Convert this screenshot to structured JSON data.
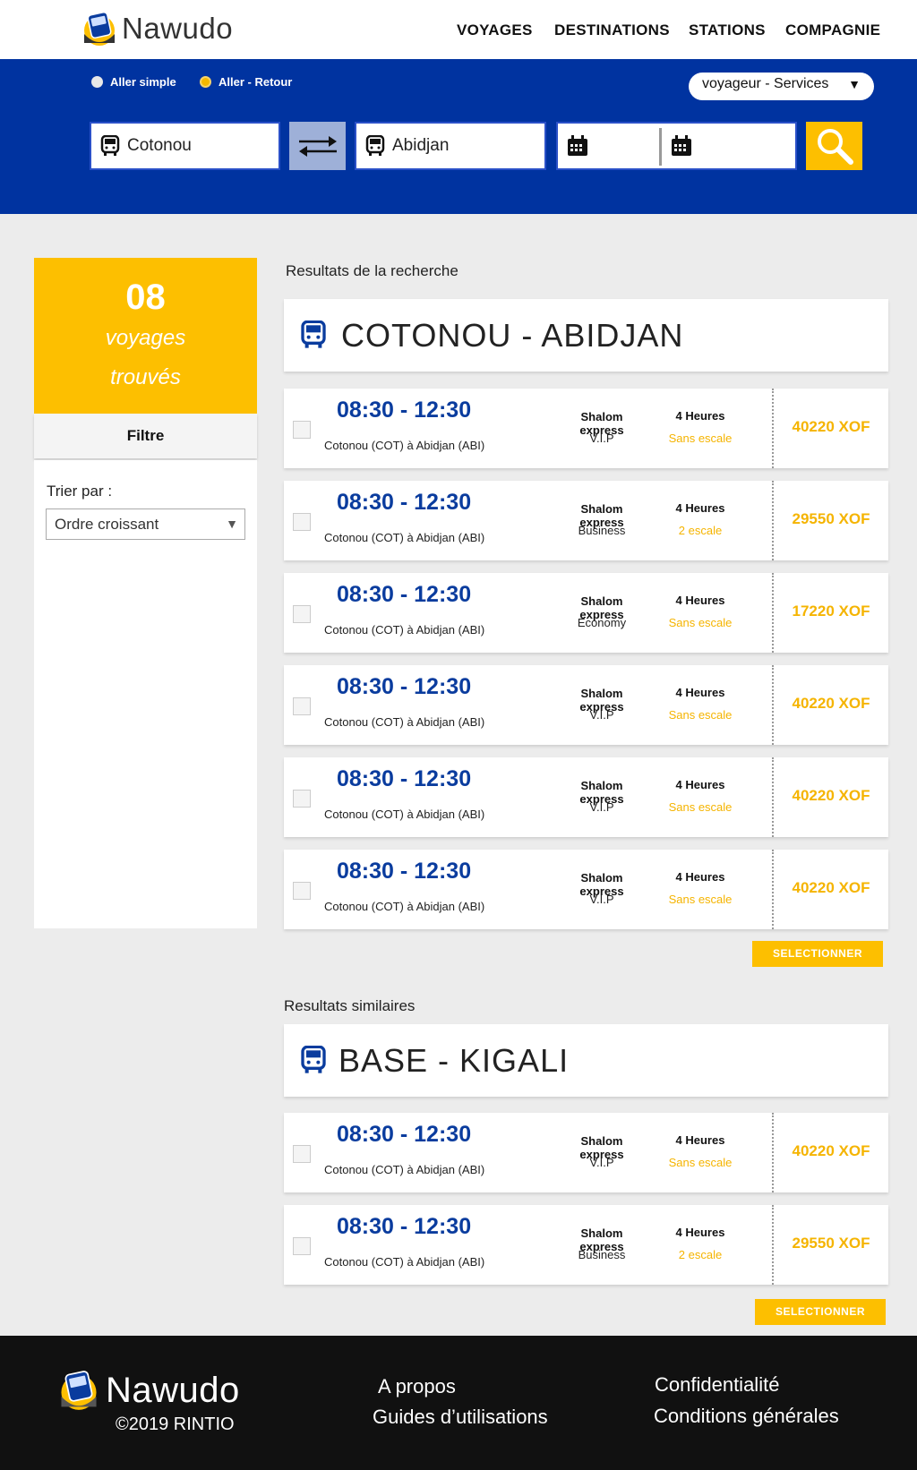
{
  "brand": {
    "name": "Nawudo"
  },
  "nav": [
    "VOYAGES",
    "DESTINATIONS",
    "STATIONS",
    "COMPAGNIE"
  ],
  "search": {
    "radio_one_way": "Aller simple",
    "radio_round_trip": "Aller - Retour",
    "selected_trip_type": "Aller - Retour",
    "services_select": "voyageur - Services",
    "from": "Cotonou",
    "to": "Abidjan"
  },
  "summary": {
    "count": "08",
    "label_line1": "voyages",
    "label_line2": "trouvés"
  },
  "filter": {
    "title": "Filtre",
    "sort_label": "Trier par :",
    "sort_value": "Ordre croissant"
  },
  "results": {
    "title": "Resultats de la recherche",
    "route": "COTONOU - ABIDJAN",
    "select_label": "SELECTIONNER",
    "trips": [
      {
        "time": "08:30 - 12:30",
        "path": "Cotonou (COT) à Abidjan (ABI)",
        "company": "Shalom express",
        "class": "V.I.P",
        "duration": "4 Heures",
        "stops": "Sans escale",
        "price": "40220 XOF"
      },
      {
        "time": "08:30 - 12:30",
        "path": "Cotonou (COT) à Abidjan (ABI)",
        "company": "Shalom express",
        "class": "Business",
        "duration": "4 Heures",
        "stops": "2 escale",
        "price": "29550 XOF"
      },
      {
        "time": "08:30 - 12:30",
        "path": "Cotonou (COT) à Abidjan (ABI)",
        "company": "Shalom express",
        "class": "Economy",
        "duration": "4 Heures",
        "stops": "Sans escale",
        "price": "17220 XOF"
      },
      {
        "time": "08:30 - 12:30",
        "path": "Cotonou (COT) à Abidjan (ABI)",
        "company": "Shalom express",
        "class": "V.I.P",
        "duration": "4 Heures",
        "stops": "Sans escale",
        "price": "40220 XOF"
      },
      {
        "time": "08:30 - 12:30",
        "path": "Cotonou (COT) à Abidjan (ABI)",
        "company": "Shalom express",
        "class": "V.I.P",
        "duration": "4 Heures",
        "stops": "Sans escale",
        "price": "40220 XOF"
      },
      {
        "time": "08:30 - 12:30",
        "path": "Cotonou (COT) à Abidjan (ABI)",
        "company": "Shalom express",
        "class": "V.I.P",
        "duration": "4 Heures",
        "stops": "Sans escale",
        "price": "40220 XOF"
      }
    ]
  },
  "similar": {
    "title": "Resultats similaires",
    "route": "BASE - KIGALI",
    "select_label": "SELECTIONNER",
    "trips": [
      {
        "time": "08:30 - 12:30",
        "path": "Cotonou (COT) à Abidjan (ABI)",
        "company": "Shalom express",
        "class": "V.I.P",
        "duration": "4 Heures",
        "stops": "Sans escale",
        "price": "40220 XOF"
      },
      {
        "time": "08:30 - 12:30",
        "path": "Cotonou (COT) à Abidjan (ABI)",
        "company": "Shalom express",
        "class": "Business",
        "duration": "4 Heures",
        "stops": "2 escale",
        "price": "29550 XOF"
      }
    ]
  },
  "footer": {
    "brand": "Nawudo",
    "copyright": "©2019 RINTIO",
    "links": [
      "A propos",
      "Guides d’utilisations",
      "Confidentialité",
      "Conditions générales"
    ]
  },
  "colors": {
    "primary_blue": "#0033a0",
    "accent_yellow": "#fdbf00",
    "time_blue": "#0a3c9e",
    "footer": "#111111"
  }
}
